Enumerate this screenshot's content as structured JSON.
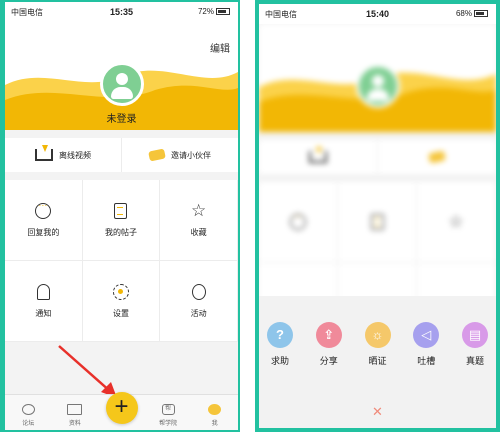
{
  "left": {
    "status": {
      "carrier": "中国电信",
      "time": "15:35",
      "battery": "72%"
    },
    "edit_label": "编辑",
    "login_label": "未登录",
    "twobar": [
      {
        "label": "离线视频",
        "icon": "download-icon"
      },
      {
        "label": "邀请小伙伴",
        "icon": "handshake-icon"
      }
    ],
    "grid": [
      {
        "label": "回复我的",
        "icon": "chat-icon"
      },
      {
        "label": "我的帖子",
        "icon": "document-icon"
      },
      {
        "label": "收藏",
        "icon": "star-icon"
      },
      {
        "label": "通知",
        "icon": "bell-icon"
      },
      {
        "label": "设置",
        "icon": "gear-icon"
      },
      {
        "label": "活动",
        "icon": "balloon-icon"
      }
    ],
    "tabs": [
      {
        "label": "论坛",
        "icon": "chat-icon"
      },
      {
        "label": "资料",
        "icon": "monitor-icon"
      },
      {
        "label": "",
        "icon": "plus-icon"
      },
      {
        "label": "帮学院",
        "icon": "help-icon"
      },
      {
        "label": "我",
        "icon": "face-icon"
      }
    ],
    "plus_label": "+",
    "help_glyph": "帮"
  },
  "right": {
    "status": {
      "carrier": "中国电信",
      "time": "15:40",
      "battery": "68%"
    },
    "actions": [
      {
        "label": "求助",
        "color": "#8ec5ea",
        "glyph": "?"
      },
      {
        "label": "分享",
        "color": "#f08a9a",
        "glyph": "⇪"
      },
      {
        "label": "晒证",
        "color": "#f5c86a",
        "glyph": "☼"
      },
      {
        "label": "吐槽",
        "color": "#a6a0ee",
        "glyph": "◁"
      },
      {
        "label": "真题",
        "color": "#d89ae8",
        "glyph": "▤"
      }
    ],
    "close_glyph": "✕"
  },
  "colors": {
    "accent": "#f5c71a",
    "frame": "#22c1a0",
    "avatar": "#7fcf93"
  }
}
